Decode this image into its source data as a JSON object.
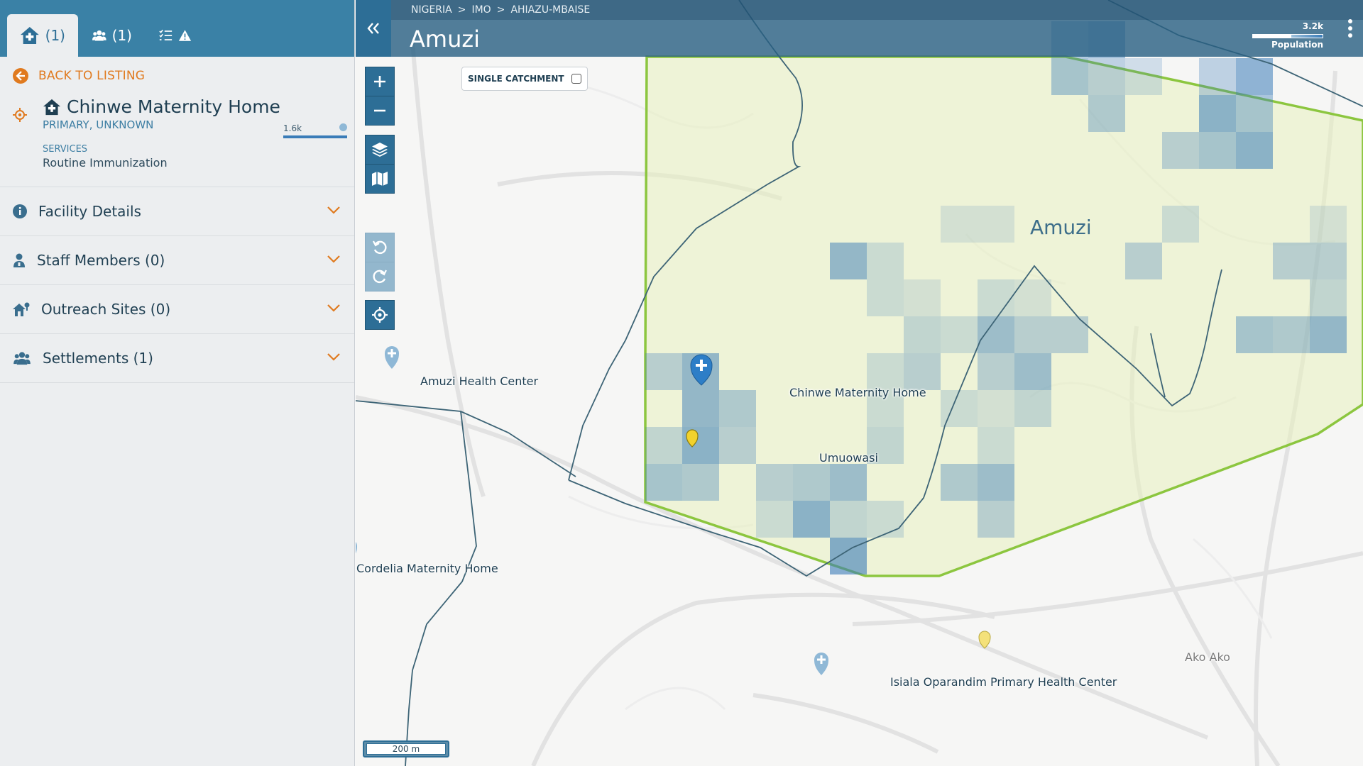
{
  "tabs": [
    {
      "icon": "facility-icon",
      "count": "(1)",
      "active": true
    },
    {
      "icon": "people-icon",
      "count": "(1)",
      "active": false
    },
    {
      "icon": "checklist-warning-icon",
      "count": "",
      "active": false
    }
  ],
  "facility": {
    "back_label": "BACK TO LISTING",
    "mini_population": "1.6k",
    "name": "Chinwe Maternity Home",
    "type": "PRIMARY, UNKNOWN",
    "services_label": "SERVICES",
    "services_value": "Routine Immunization"
  },
  "accordion": [
    {
      "icon": "info-icon",
      "label": "Facility Details"
    },
    {
      "icon": "staff-icon",
      "label": "Staff Members (0)"
    },
    {
      "icon": "outreach-icon",
      "label": "Outreach Sites (0)"
    },
    {
      "icon": "settlements-icon",
      "label": "Settlements (1)"
    }
  ],
  "header": {
    "breadcrumb": [
      "NIGERIA",
      ">",
      "IMO",
      ">",
      "AHIAZU-MBAISE"
    ],
    "title": "Amuzi",
    "population_value": "3.2k",
    "population_label": "Population"
  },
  "map": {
    "single_catchment_label": "SINGLE CATCHMENT",
    "region_label": "Amuzi",
    "scale_label": "200 m",
    "places": {
      "amuzi_hc": "Amuzi Health Center",
      "chinwe": "Chinwe Maternity Home",
      "umuowasi": "Umuowasi",
      "cordelia": "Cordelia Maternity Home",
      "isiala": "Isiala Oparandim Primary Health Center",
      "ako_ako": "Ako Ako"
    }
  },
  "colors": {
    "header_blue": "#3a81a6",
    "accent_orange": "#e07a1f",
    "catchment_green": "#8cc63f",
    "pop_blue": "#3a7cb8"
  }
}
